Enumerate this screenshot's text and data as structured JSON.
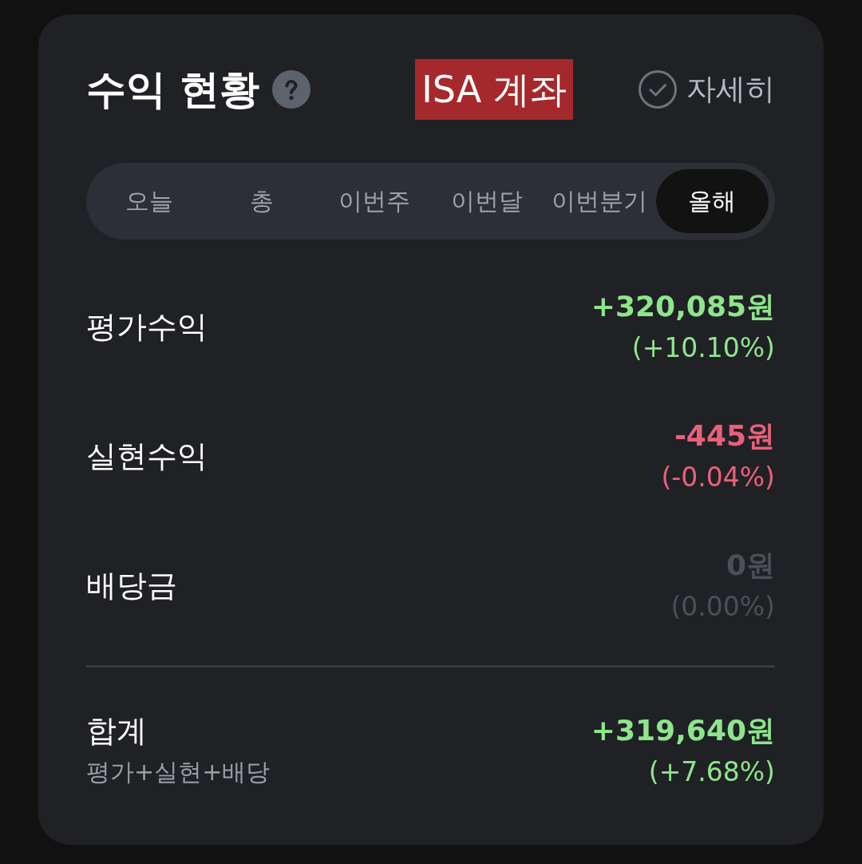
{
  "header": {
    "title": "수익 현황",
    "account_label": "ISA 계좌",
    "detail_link": "자세히"
  },
  "tabs": [
    {
      "label": "오늘",
      "selected": false
    },
    {
      "label": "총",
      "selected": false
    },
    {
      "label": "이번주",
      "selected": false
    },
    {
      "label": "이번달",
      "selected": false
    },
    {
      "label": "이번분기",
      "selected": false
    },
    {
      "label": "올해",
      "selected": true
    }
  ],
  "rows": [
    {
      "label": "평가수익",
      "amount": "+320,085원",
      "rate": "(+10.10%)",
      "color": "#8ee58c"
    },
    {
      "label": "실현수익",
      "amount": "-445원",
      "rate": "(-0.04%)",
      "color": "#e8617a"
    },
    {
      "label": "배당금",
      "amount": "0원",
      "rate": "(0.00%)",
      "color": "#4a4f57"
    }
  ],
  "total": {
    "label": "합계",
    "sublabel": "평가+실현+배당",
    "amount": "+319,640원",
    "rate": "(+7.68%)",
    "color": "#8ee58c"
  }
}
